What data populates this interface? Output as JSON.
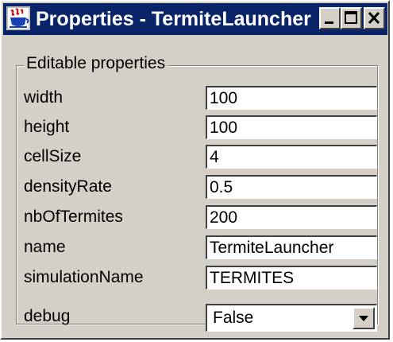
{
  "window": {
    "title": "Properties - TermiteLauncher",
    "icon": "java-cup-icon",
    "controls": [
      "minimize",
      "maximize",
      "close"
    ]
  },
  "group": {
    "title": "Editable properties"
  },
  "properties": [
    {
      "label": "width",
      "value": "100"
    },
    {
      "label": "height",
      "value": "100"
    },
    {
      "label": "cellSize",
      "value": "4"
    },
    {
      "label": "densityRate",
      "value": "0.5"
    },
    {
      "label": "nbOfTermites",
      "value": "200"
    },
    {
      "label": "name",
      "value": "TermiteLauncher"
    },
    {
      "label": "simulationName",
      "value": "TERMITES"
    }
  ],
  "debug": {
    "label": "debug",
    "selected": "False"
  },
  "colors": {
    "titlebar": "#0a246a",
    "face": "#d4d0c8"
  }
}
